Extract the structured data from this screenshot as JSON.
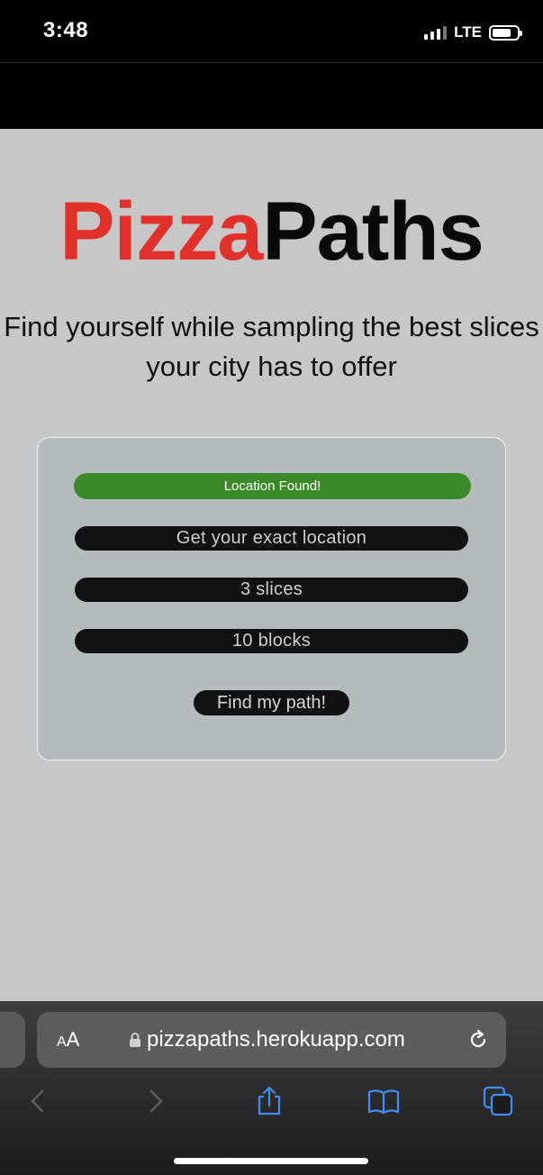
{
  "status_bar": {
    "time": "3:48",
    "network": "LTE"
  },
  "logo": {
    "part1": "Pizza",
    "part2": "Paths",
    "colors": {
      "pizza": "#e2312a",
      "paths": "#0a0a0a"
    }
  },
  "tagline": "Find yourself while sampling the best slices your city has to offer",
  "panel": {
    "status_text": "Location Found!",
    "status_color": "#3b8a2a",
    "location_button": "Get your exact location",
    "slices_field": "3 slices",
    "blocks_field": "10 blocks",
    "submit_button": "Find my path!"
  },
  "browser": {
    "text_size_button": {
      "small": "A",
      "large": "A"
    },
    "url": "pizzapaths.herokuapp.com",
    "icons": [
      "lock-icon",
      "reload-icon",
      "back-icon",
      "forward-icon",
      "share-icon",
      "bookmarks-icon",
      "tabs-icon"
    ]
  }
}
